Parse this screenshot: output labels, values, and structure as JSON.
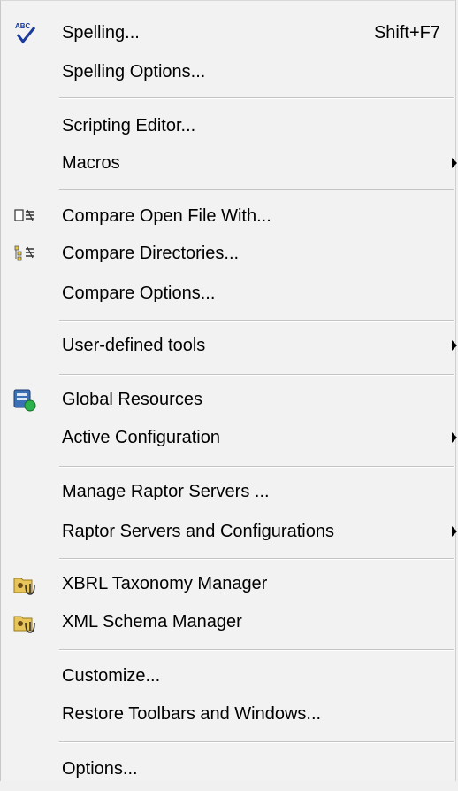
{
  "menu": {
    "spelling": {
      "label": "Spelling...",
      "shortcut": "Shift+F7",
      "icon": "spellcheck-icon"
    },
    "spelling_options": {
      "label": "Spelling Options..."
    },
    "scripting_editor": {
      "label": "Scripting Editor..."
    },
    "macros": {
      "label": "Macros",
      "submenu": true
    },
    "compare_open_file": {
      "label": "Compare Open File With...",
      "icon": "compare-file-icon"
    },
    "compare_directories": {
      "label": "Compare Directories...",
      "icon": "compare-directories-icon"
    },
    "compare_options": {
      "label": "Compare Options..."
    },
    "user_defined_tools": {
      "label": "User-defined tools",
      "submenu": true
    },
    "global_resources": {
      "label": "Global Resources",
      "icon": "global-resources-icon"
    },
    "active_configuration": {
      "label": "Active Configuration",
      "submenu": true
    },
    "manage_raptor_servers": {
      "label": "Manage Raptor Servers ..."
    },
    "raptor_servers_configurations": {
      "label": "Raptor Servers and Configurations",
      "submenu": true
    },
    "xbrl_taxonomy_manager": {
      "label": "XBRL Taxonomy Manager",
      "icon": "taxonomy-manager-icon"
    },
    "xml_schema_manager": {
      "label": "XML Schema Manager",
      "icon": "schema-manager-icon"
    },
    "customize": {
      "label": "Customize..."
    },
    "restore_toolbars": {
      "label": "Restore Toolbars and Windows..."
    },
    "options": {
      "label": "Options..."
    }
  },
  "colors": {
    "menu_background": "#f2f2f2",
    "separator": "#c4c4c4",
    "text": "#000000",
    "spellcheck_blue": "#1a3a9c",
    "resources_green": "#2bb24c"
  }
}
